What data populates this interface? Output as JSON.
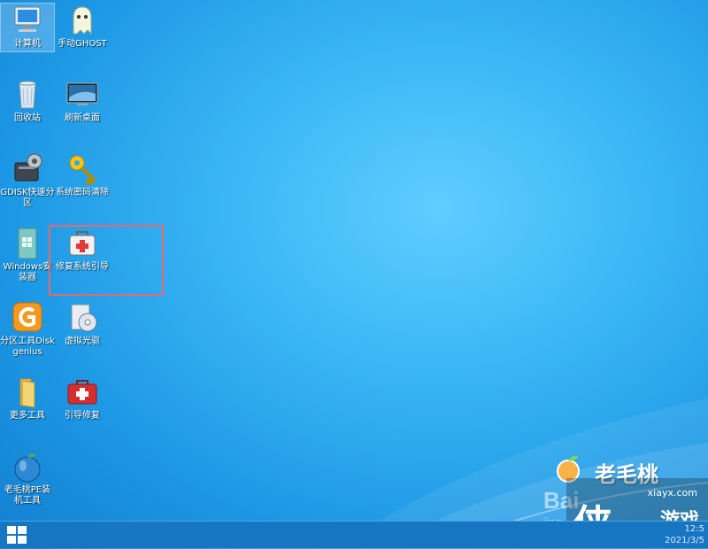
{
  "desktop": {
    "icons": [
      {
        "label": "计算机",
        "icon": "computer-icon"
      },
      {
        "label": "手动GHOST",
        "icon": "ghost-icon"
      },
      {
        "label": "回收站",
        "icon": "recycle-bin-icon"
      },
      {
        "label": "刷新桌面",
        "icon": "monitor-icon"
      },
      {
        "label": "GDISK快速分区",
        "icon": "disk-gear-icon"
      },
      {
        "label": "系统密码清除",
        "icon": "key-icon"
      },
      {
        "label": "Windows安装器",
        "icon": "windows-installer-icon"
      },
      {
        "label": "修复系统引导",
        "icon": "toolbox-icon"
      },
      {
        "label": "分区工具Diskgenius",
        "icon": "diskgenius-icon"
      },
      {
        "label": "虚拟光驱",
        "icon": "virtual-drive-icon"
      },
      {
        "label": "更多工具",
        "icon": "folder-icon"
      },
      {
        "label": "引导修复",
        "icon": "medkit-icon"
      },
      {
        "label": "老毛桃PE装机工具",
        "icon": "peach-icon"
      }
    ]
  },
  "brand": {
    "name": "老毛桃",
    "logo": "peach-logo"
  },
  "watermark": {
    "site": "xiayx.com",
    "char": "侠",
    "sub": "游戏",
    "baidu": "Bai",
    "baidu_url": "jing"
  },
  "taskbar": {
    "start": "windows-start-icon",
    "time": "12:5",
    "date": "2021/3/5"
  },
  "colors": {
    "desktop": "#2aa9ef",
    "taskbar": "#1676c2",
    "highlight": "#e8696d"
  }
}
